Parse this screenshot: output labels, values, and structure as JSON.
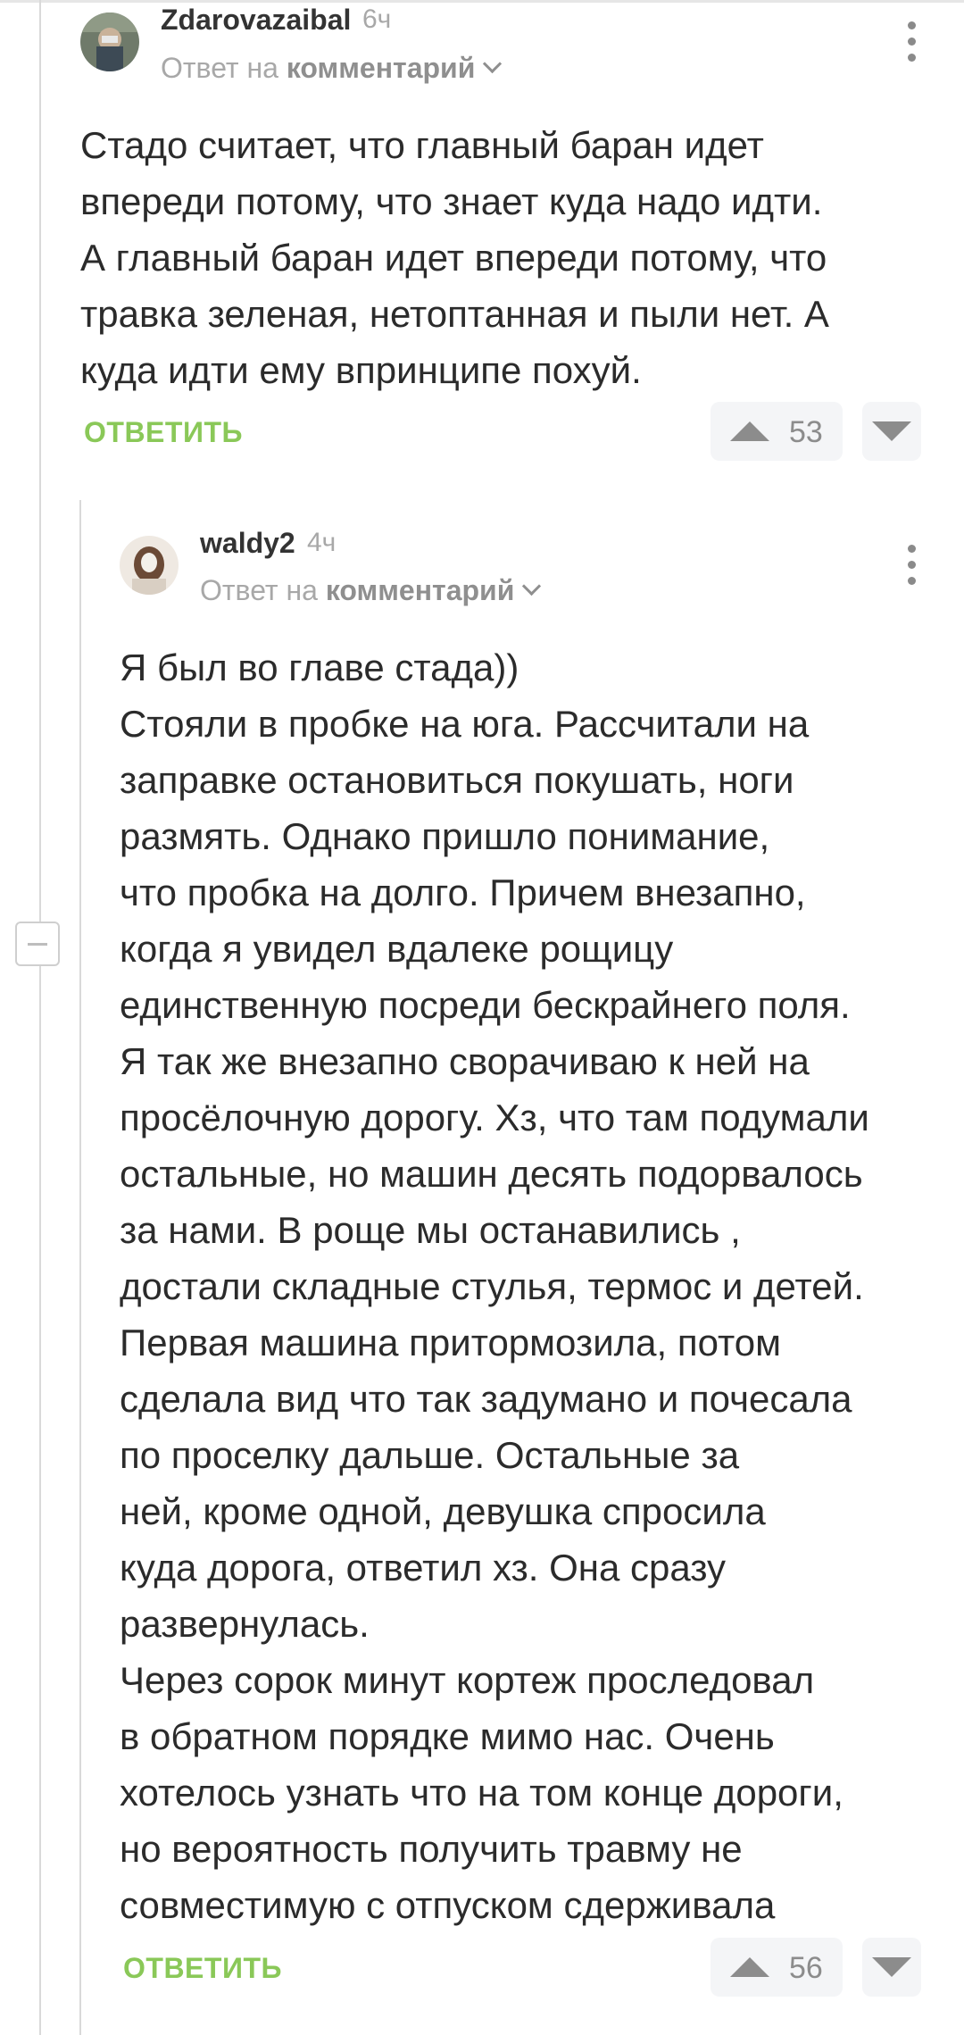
{
  "comments": [
    {
      "username": "Zdarovazaibal",
      "time": "6ч",
      "reply_to_prefix": "Ответ на",
      "reply_to_link": "комментарий",
      "text": "Стадо считает, что главный баран идет\nвпереди потому, что знает куда надо идти.\nА главный баран идет впереди потому, что\nтравка зеленая, нетоптанная и пыли нет. А\nкуда идти ему впринципе похуй.",
      "reply_label": "ОТВЕТИТЬ",
      "rating": "53"
    },
    {
      "username": "waldy2",
      "time": "4ч",
      "reply_to_prefix": "Ответ на",
      "reply_to_link": "комментарий",
      "text": "Я был во главе стада))\nСтояли в пробке на юга. Рассчитали на\nзаправке остановиться покушать, ноги\nразмять. Однако пришло понимание,\nчто пробка на долго. Причем внезапно,\nкогда я увидел вдалеке рощицу\nединственную посреди бескрайнего поля.\nЯ так же внезапно сворачиваю к ней на\nпросёлочную дорогу. Хз, что там подумали\nостальные, но машин десять подорвалось\nза нами. В роще мы останавились ,\nдостали складные стулья, термос и детей.\nПервая машина притормозила, потом\nсделала вид что так задумано и почесала\nпо проселку дальше. Остальные за\nней, кроме одной, девушка спросила\nкуда дорога, ответил хз. Она сразу\nразвернулась.\nЧерез сорок минут кортеж проследовал\nв обратном порядке мимо нас. Очень\nхотелось узнать что на том конце дороги,\nно вероятность получить травму не\nсовместимую с отпуском сдерживала",
      "reply_label": "ОТВЕТИТЬ",
      "rating": "56"
    }
  ],
  "icons": {
    "vote_up": "triangle-up-icon",
    "vote_down": "triangle-down-icon",
    "more": "kebab-icon",
    "collapse": "minus-square-icon"
  },
  "colors": {
    "accent": "#8ac858",
    "muted": "#a8a8a8",
    "text": "#2b2b2b"
  }
}
